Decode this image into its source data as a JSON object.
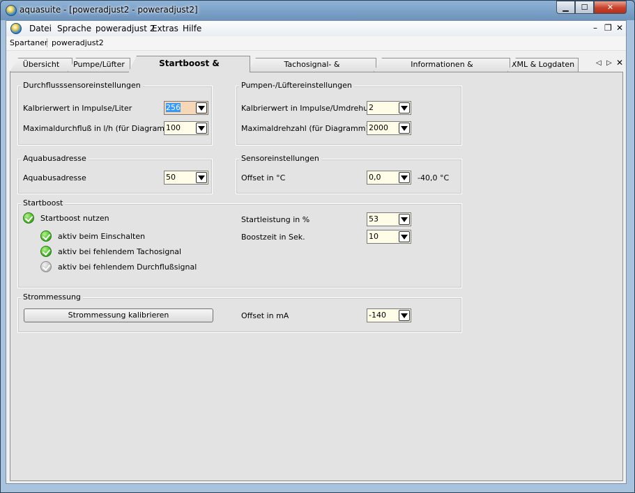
{
  "window": {
    "title": "aquasuite - [poweradjust2 - poweradjust2]"
  },
  "menu": {
    "items": [
      "Datei",
      "Sprache",
      "poweradjust 2",
      "Extras",
      "Hilfe"
    ]
  },
  "breadcrumb": {
    "items": [
      "Spartaner",
      "poweradjust2"
    ]
  },
  "tabs": [
    "Übersicht",
    "Pumpe/Lüfter",
    "Startboost & Kalibrierwerte",
    "Tachosignal- & Alarmeinstellungen",
    "Informationen & Schlüsselverwaltung",
    "XML & Logdaten"
  ],
  "active_tab": "Startboost & Kalibrierwerte",
  "flow_group": {
    "title": "Durchflusssensoreinstellungen",
    "calib_label": "Kalbrierwert in Impulse/Liter",
    "calib_value": "256",
    "max_label": "Maximaldurchfluß in l/h (für Diagramm)",
    "max_value": "100"
  },
  "pump_group": {
    "title": "Pumpen-/Lüftereinstellungen",
    "calib_label": "Kalbrierwert in Impulse/Umdrehung",
    "calib_value": "2",
    "max_label": "Maximaldrehzahl (für Diagramm)",
    "max_value": "2000"
  },
  "aquabus_group": {
    "title": "Aquabusadresse",
    "label": "Aquabusadresse",
    "value": "50"
  },
  "sensor_group": {
    "title": "Sensoreinstellungen",
    "label": "Offset in °C",
    "value": "0,0",
    "reading": "-40,0 °C"
  },
  "startboost_group": {
    "title": "Startboost",
    "use_label": "Startboost nutzen",
    "options": [
      {
        "label": "aktiv beim Einschalten",
        "checked": true
      },
      {
        "label": "aktiv bei fehlendem Tachosignal",
        "checked": true
      },
      {
        "label": "aktiv bei fehlendem Durchflußsignal",
        "checked": false
      }
    ],
    "power_label": "Startleistung in %",
    "power_value": "53",
    "boost_label": "Boostzeit in Sek.",
    "boost_value": "10"
  },
  "current_group": {
    "title": "Strommessung",
    "button_label": "Strommessung kalibrieren",
    "offset_label": "Offset in mA",
    "offset_value": "-140"
  }
}
